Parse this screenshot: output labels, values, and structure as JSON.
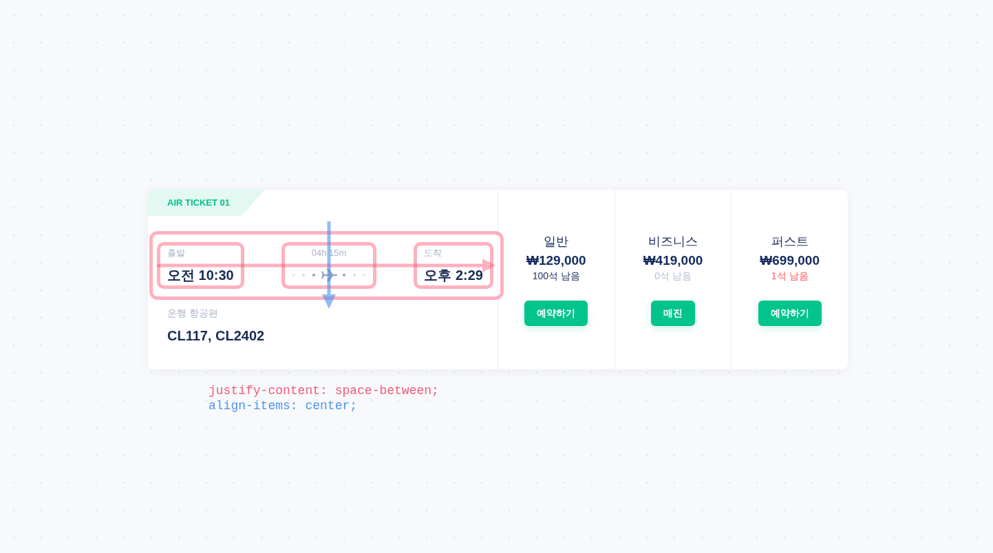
{
  "ticket": {
    "label": "AIR TICKET 01",
    "departure": {
      "label": "출발",
      "time": "오전 10:30"
    },
    "duration": "04h 15m",
    "arrival": {
      "label": "도착",
      "time": "오후 2:29"
    },
    "flights": {
      "label": "운행 항공편",
      "value": "CL117, CL2402"
    }
  },
  "fares": [
    {
      "name": "일반",
      "price": "₩129,000",
      "seats": {
        "text": "100석 남음",
        "color": "#1d2d5c"
      },
      "button": "예약하기"
    },
    {
      "name": "비즈니스",
      "price": "₩419,000",
      "seats": {
        "text": "0석 남음",
        "color": "#b4bfd4"
      },
      "button": "매진"
    },
    {
      "name": "퍼스트",
      "price": "₩699,000",
      "seats": {
        "text": "1석 남음",
        "color": "#ff5a5f"
      },
      "button": "예약하기"
    }
  ],
  "code_lines": [
    {
      "text": "justify-content: space-between;",
      "color": "#f25a74"
    },
    {
      "text": "align-items: center;",
      "color": "#4d94ec"
    }
  ]
}
